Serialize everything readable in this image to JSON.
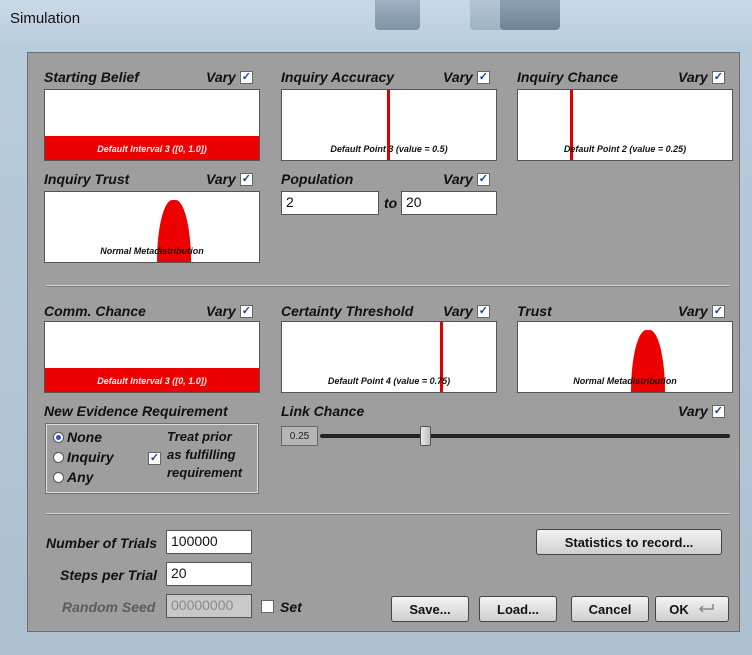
{
  "window": {
    "title": "Simulation"
  },
  "vary_label": "Vary",
  "check_mark": "✓",
  "params": {
    "starting_belief": {
      "label": "Starting Belief",
      "vary": true,
      "caption": "Default Interval 3 ([0, 1.0])"
    },
    "inquiry_accuracy": {
      "label": "Inquiry Accuracy",
      "vary": true,
      "caption": "Default Point 3 (value = 0.5)"
    },
    "inquiry_chance": {
      "label": "Inquiry Chance",
      "vary": true,
      "caption": "Default Point 2 (value = 0.25)"
    },
    "inquiry_trust": {
      "label": "Inquiry Trust",
      "vary": true,
      "caption": "Normal Metadistribution"
    },
    "population": {
      "label": "Population",
      "vary": true,
      "min": "2",
      "to_label": "to",
      "max": "20"
    },
    "comm_chance": {
      "label": "Comm. Chance",
      "vary": true,
      "caption": "Default Interval 3 ([0, 1.0])"
    },
    "certainty_threshold": {
      "label": "Certainty Threshold",
      "vary": true,
      "caption": "Default Point 4 (value = 0.75)"
    },
    "trust": {
      "label": "Trust",
      "vary": true,
      "caption": "Normal Metadistribution"
    }
  },
  "new_evidence": {
    "label": "New Evidence Requirement",
    "options": [
      "None",
      "Inquiry",
      "Any"
    ],
    "selected": "None",
    "treat_prior_lines": [
      "Treat prior",
      "as fulfilling",
      "requirement"
    ],
    "treat_prior_checked": true
  },
  "link_chance": {
    "label": "Link Chance",
    "vary": true,
    "value": "0.25",
    "fraction": 0.25
  },
  "trials": {
    "label": "Number of Trials",
    "value": "100000"
  },
  "steps": {
    "label": "Steps per Trial",
    "value": "20"
  },
  "seed": {
    "label": "Random Seed",
    "value": "00000000",
    "set_label": "Set",
    "set_checked": false
  },
  "buttons": {
    "statistics": "Statistics to record...",
    "save": "Save...",
    "load": "Load...",
    "cancel": "Cancel",
    "ok": "OK"
  }
}
